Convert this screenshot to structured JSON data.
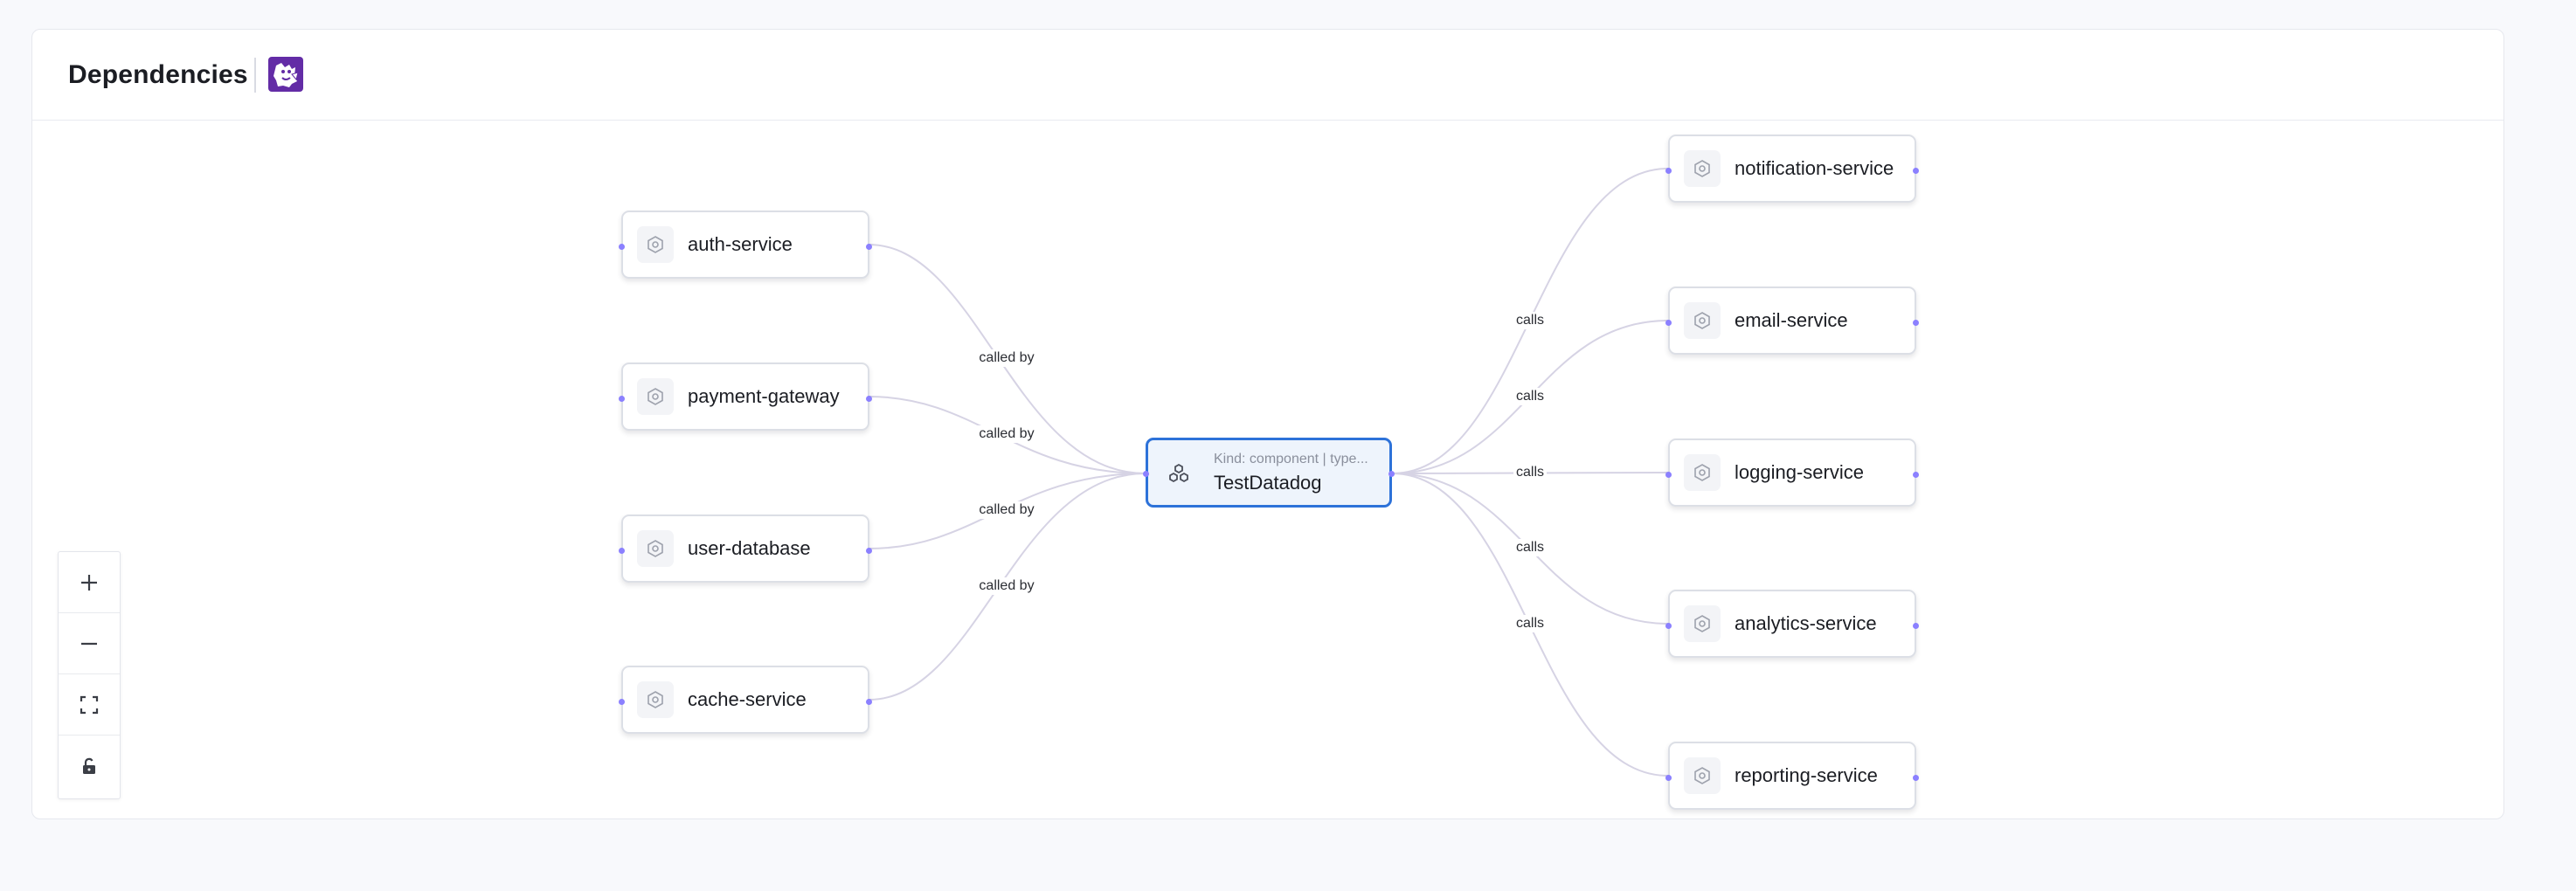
{
  "header": {
    "title": "Dependencies",
    "logo_icon": "datadog-logo-icon",
    "logo_color": "#632ca6"
  },
  "graph": {
    "center": {
      "kind_text": "Kind: component | type...",
      "name": "TestDatadog",
      "icon": "component-cluster-icon",
      "border_color": "#2d72d9"
    },
    "upstream": [
      {
        "label": "auth-service",
        "edge_label": "called by",
        "icon": "service-icon"
      },
      {
        "label": "payment-gateway",
        "edge_label": "called by",
        "icon": "service-icon"
      },
      {
        "label": "user-database",
        "edge_label": "called by",
        "icon": "service-icon"
      },
      {
        "label": "cache-service",
        "edge_label": "called by",
        "icon": "service-icon"
      }
    ],
    "downstream": [
      {
        "label": "notification-service",
        "edge_label": "calls",
        "icon": "service-icon"
      },
      {
        "label": "email-service",
        "edge_label": "calls",
        "icon": "service-icon"
      },
      {
        "label": "logging-service",
        "edge_label": "calls",
        "icon": "service-icon"
      },
      {
        "label": "analytics-service",
        "edge_label": "calls",
        "icon": "service-icon"
      },
      {
        "label": "reporting-service",
        "edge_label": "calls",
        "icon": "service-icon"
      }
    ],
    "handle_color": "#8b80ff",
    "edge_color": "#d6d3e4"
  },
  "controls": [
    {
      "name": "zoom-in",
      "icon": "plus-icon"
    },
    {
      "name": "zoom-out",
      "icon": "minus-icon"
    },
    {
      "name": "fit-view",
      "icon": "fit-view-icon"
    },
    {
      "name": "toggle-lock",
      "icon": "unlock-icon"
    }
  ]
}
